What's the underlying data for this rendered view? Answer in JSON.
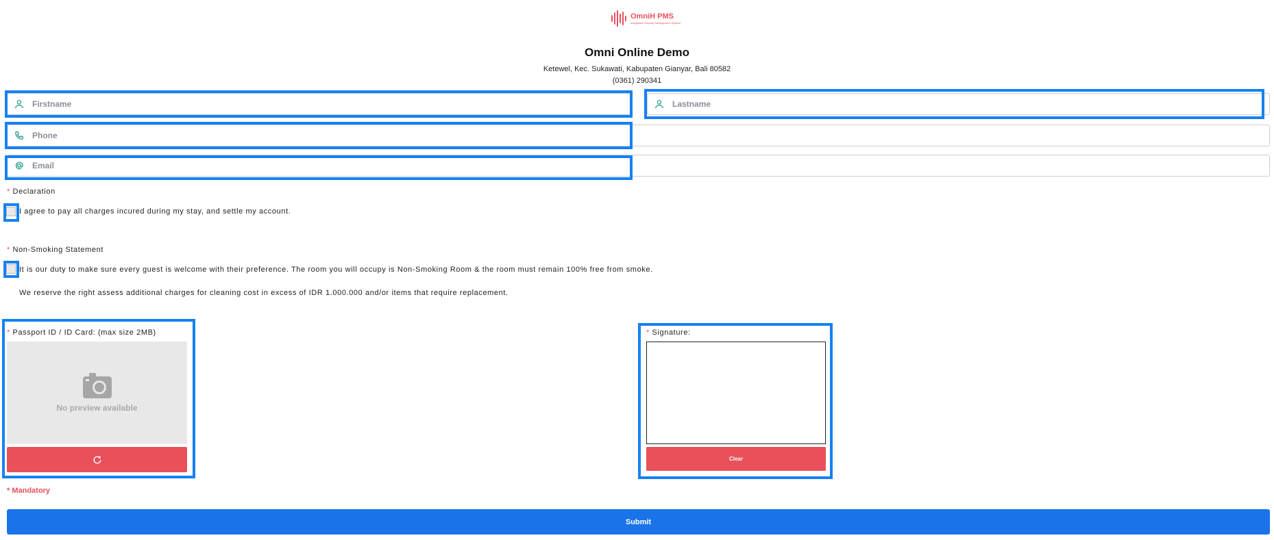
{
  "header": {
    "logo_text": "OmniH PMS",
    "logo_tagline": "Integrated Property Management System",
    "hotel_name": "Omni Online Demo",
    "address": "Ketewel, Kec. Sukawati, Kabupaten Gianyar, Bali 80582",
    "phone": "(0361) 290341"
  },
  "form": {
    "firstname": {
      "placeholder": "Firstname",
      "value": "",
      "icon": "user-icon"
    },
    "lastname": {
      "placeholder": "Lastname",
      "value": "",
      "icon": "user-icon"
    },
    "phone": {
      "placeholder": "Phone",
      "value": "",
      "icon": "phone-icon"
    },
    "email": {
      "placeholder": "Email",
      "value": "",
      "icon": "at-icon"
    }
  },
  "declaration": {
    "required_mark": "*",
    "title": "Declaration",
    "text": "I agree to pay all charges incured during my stay, and settle my account.",
    "checked": false
  },
  "non_smoking": {
    "required_mark": "*",
    "title": "Non-Smoking Statement",
    "text": "It is our duty to make sure every guest is welcome with their preference. The room you will occupy is Non-Smoking Room & the room must remain 100% free from smoke.",
    "text2": "We reserve the right assess additional charges for cleaning cost in excess of IDR 1.000.000 and/or items that require replacement.",
    "checked": false
  },
  "passport": {
    "required_mark": "*",
    "label": "Passport ID / ID Card: (max size 2MB)",
    "preview_text": "No preview available",
    "button_icon": "refresh-icon"
  },
  "signature": {
    "required_mark": "*",
    "label": "Signature:",
    "clear_label": "Clear"
  },
  "mandatory_note": "* Mandatory",
  "submit_label": "Submit",
  "colors": {
    "accent_red": "#e8505b",
    "submit_blue": "#1a73e8",
    "highlight_blue": "#1581f2",
    "icon_teal": "#1a9a8a"
  }
}
